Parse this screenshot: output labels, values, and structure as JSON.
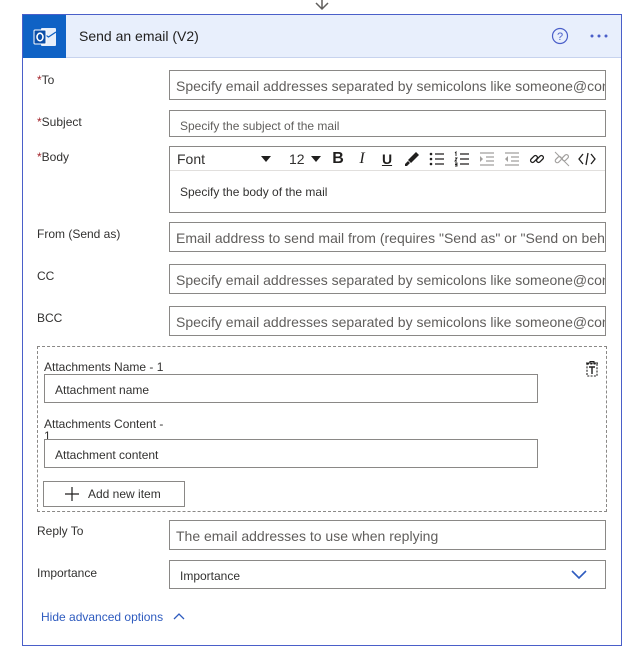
{
  "card": {
    "title": "Send an email (V2)",
    "app_icon": "outlook-icon",
    "header_icons": [
      "help-icon",
      "more-icon"
    ]
  },
  "fields": {
    "to": {
      "label": "To",
      "required": "*",
      "placeholder": "Specify email addresses separated by semicolons like someone@con"
    },
    "subject": {
      "label": "Subject",
      "required": "*",
      "placeholder": "Specify the subject of the mail"
    },
    "body": {
      "label": "Body",
      "required": "*",
      "placeholder": "Specify the body of the mail"
    },
    "from": {
      "label": "From (Send as)",
      "placeholder": "Email address to send mail from (requires \"Send as\" or \"Send on beh"
    },
    "cc": {
      "label": "CC",
      "placeholder": "Specify email addresses separated by semicolons like someone@con"
    },
    "bcc": {
      "label": "BCC",
      "placeholder": "Specify email addresses separated by semicolons like someone@con"
    },
    "reply_to": {
      "label": "Reply To",
      "placeholder": "The email addresses to use when replying"
    },
    "importance": {
      "label": "Importance",
      "value": "Importance"
    }
  },
  "editor": {
    "font": "Font",
    "size": "12",
    "bold": "B",
    "italic": "I",
    "underline": "U",
    "toolbar_icons": [
      "paint-brush-icon",
      "bullet-list-icon",
      "numbered-list-icon",
      "indent-icon",
      "outdent-icon",
      "link-icon",
      "unlink-icon",
      "code-view-icon"
    ]
  },
  "attachments": {
    "name_label": "Attachments Name - 1",
    "name_placeholder": "Attachment name",
    "content_label_line1": "Attachments Content -",
    "content_label_line2": "1",
    "content_placeholder": "Attachment content",
    "add_button": "Add new item"
  },
  "footer": {
    "hide_link": "Hide advanced options"
  },
  "colors": {
    "accent": "#4a5fc9",
    "header_bg": "#e8effc",
    "required": "#a4262c",
    "link": "#2e5bbf"
  }
}
